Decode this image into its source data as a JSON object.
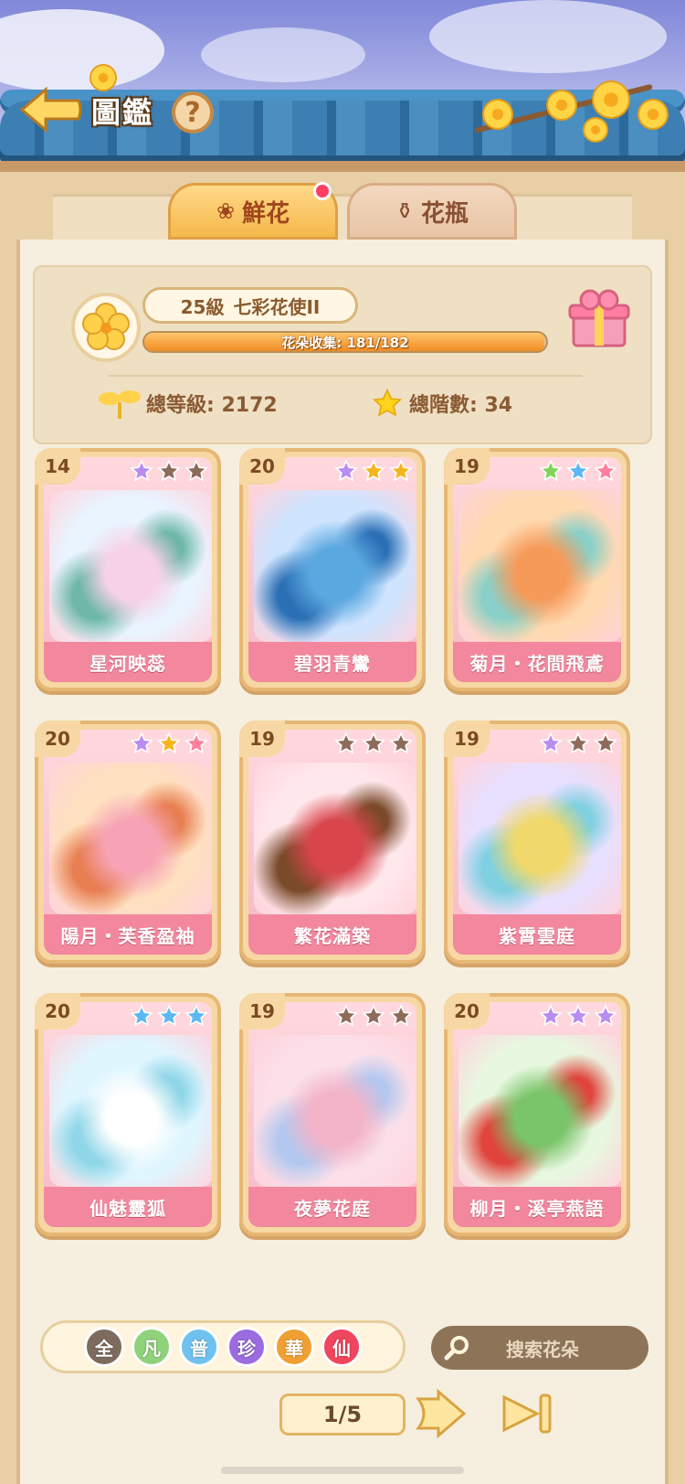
{
  "header": {
    "title": "圖鑑",
    "help_label": "?"
  },
  "tabs": [
    {
      "label": "鮮花",
      "active": true,
      "has_notification": true
    },
    {
      "label": "花瓶",
      "active": false
    }
  ],
  "stats": {
    "level_number": "25級",
    "level_title": "七彩花使II",
    "progress_text": "花朵收集: 181/182",
    "progress_fraction": 0.9945,
    "total_level": "總等級: 2172",
    "total_stars": "總階數: 34"
  },
  "cards": [
    {
      "level": "14",
      "name": "星河映蕊",
      "stars": [
        "#b98cf0",
        "#8e6a5a",
        "#8e6a5a"
      ],
      "art": [
        "#e9f4ff",
        "#f7d2e6",
        "#6fb7a8"
      ]
    },
    {
      "level": "20",
      "name": "碧羽青鸞",
      "stars": [
        "#b98cf0",
        "#f5b51e",
        "#f5b51e"
      ],
      "art": [
        "#cfe4ff",
        "#5aa8e0",
        "#2b6fb5"
      ]
    },
    {
      "level": "19",
      "name": "菊月・花間飛鳶",
      "stars": [
        "#7fd45a",
        "#5db8f2",
        "#ff7f9c"
      ],
      "art": [
        "#ffd9b0",
        "#f69a5a",
        "#8ad0c8"
      ]
    },
    {
      "level": "20",
      "name": "陽月・芙香盈袖",
      "stars": [
        "#b98cf0",
        "#f5b51e",
        "#ff7f9c"
      ],
      "art": [
        "#ffe0c0",
        "#f7a3b5",
        "#e87f52"
      ]
    },
    {
      "level": "19",
      "name": "繁花滿築",
      "stars": [
        "#8e6a5a",
        "#8e6a5a",
        "#8e6a5a"
      ],
      "art": [
        "#ffe8ec",
        "#d8454b",
        "#7a4a2a"
      ]
    },
    {
      "level": "19",
      "name": "紫霄雲庭",
      "stars": [
        "#b98cf0",
        "#8e6a5a",
        "#8e6a5a"
      ],
      "art": [
        "#e8e0ff",
        "#f0d86a",
        "#7fd0e0"
      ]
    },
    {
      "level": "20",
      "name": "仙魅靈狐",
      "stars": [
        "#5db8f2",
        "#5db8f2",
        "#5db8f2"
      ],
      "art": [
        "#dff6ff",
        "#ffffff",
        "#8fd6e8"
      ]
    },
    {
      "level": "19",
      "name": "夜夢花庭",
      "stars": [
        "#8e6a5a",
        "#8e6a5a",
        "#8e6a5a"
      ],
      "art": [
        "#fbe0ea",
        "#f3b3c8",
        "#b4c8ef"
      ]
    },
    {
      "level": "20",
      "name": "柳月・溪亭燕語",
      "stars": [
        "#b98cf0",
        "#b98cf0",
        "#b98cf0"
      ],
      "art": [
        "#e8f8e0",
        "#7ac46a",
        "#e0443c"
      ]
    }
  ],
  "filters": [
    {
      "label": "全",
      "color": "#7d6b5d"
    },
    {
      "label": "凡",
      "color": "#8fd27a"
    },
    {
      "label": "普",
      "color": "#6fc2ef"
    },
    {
      "label": "珍",
      "color": "#9d6be0"
    },
    {
      "label": "華",
      "color": "#f0a032"
    },
    {
      "label": "仙",
      "color": "#f0455e"
    }
  ],
  "search": {
    "placeholder": "搜索花朵"
  },
  "pager": {
    "text": "1/5"
  }
}
